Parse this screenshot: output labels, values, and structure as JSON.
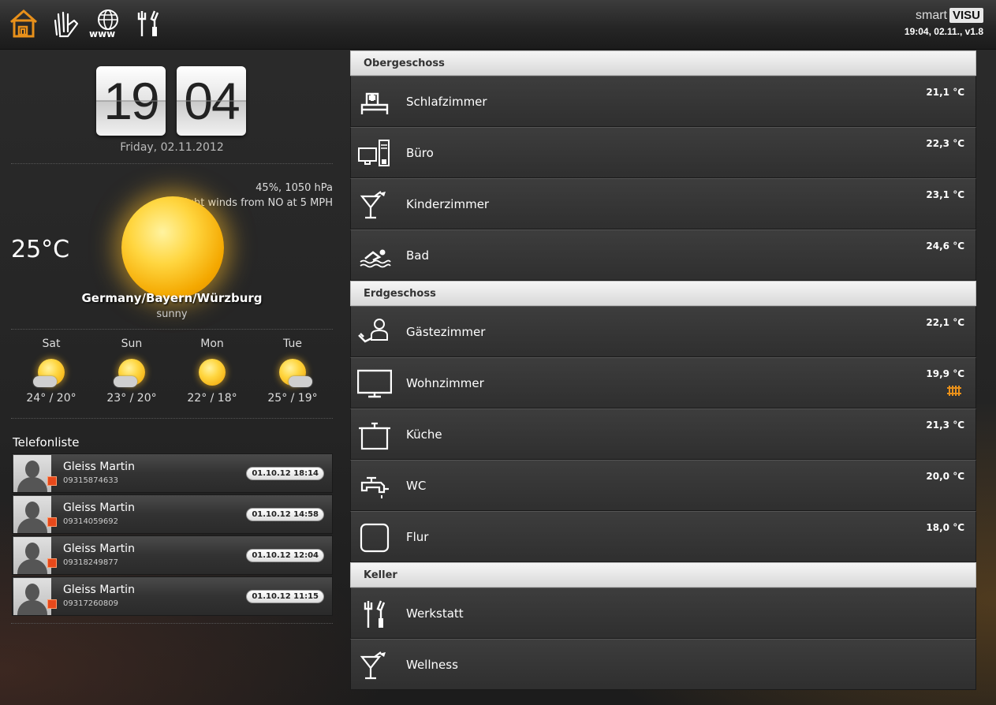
{
  "topbar": {
    "icons": [
      "home-icon",
      "hand-icon",
      "www-icon",
      "tools-icon"
    ],
    "brand_smart": "smart",
    "brand_visu": "VISU",
    "version": "19:04, 02.11., v1.8",
    "accent": "#e8901a"
  },
  "clock": {
    "hours": "19",
    "minutes": "04",
    "date": "Friday, 02.11.2012"
  },
  "weather": {
    "humidity_pressure": "45%, 1050 hPa",
    "wind": "light winds from NO at 5 MPH",
    "temperature": "25°C",
    "location": "Germany/Bayern/Würzburg",
    "condition": "sunny",
    "forecast": [
      {
        "day": "Sat",
        "range": "24° / 20°",
        "icon": "sun-cloud-icon"
      },
      {
        "day": "Sun",
        "range": "23° / 20°",
        "icon": "sun-cloud-icon"
      },
      {
        "day": "Mon",
        "range": "22° / 18°",
        "icon": "sun-icon"
      },
      {
        "day": "Tue",
        "range": "25° / 19°",
        "icon": "sun-cloud-icon"
      }
    ]
  },
  "phonelist": {
    "title": "Telefonliste",
    "calls": [
      {
        "name": "Gleiss Martin",
        "number": "09315874633",
        "time": "01.10.12 18:14"
      },
      {
        "name": "Gleiss Martin",
        "number": "09314059692",
        "time": "01.10.12 14:58"
      },
      {
        "name": "Gleiss Martin",
        "number": "09318249877",
        "time": "01.10.12 12:04"
      },
      {
        "name": "Gleiss Martin",
        "number": "09317260809",
        "time": "01.10.12 11:15"
      }
    ]
  },
  "floors": [
    {
      "title": "Obergeschoss",
      "rooms": [
        {
          "name": "Schlafzimmer",
          "temp": "21,1 °C",
          "icon": "bed-icon"
        },
        {
          "name": "Büro",
          "temp": "22,3 °C",
          "icon": "computer-icon"
        },
        {
          "name": "Kinderzimmer",
          "temp": "23,1 °C",
          "icon": "cocktail-icon"
        },
        {
          "name": "Bad",
          "temp": "24,6 °C",
          "icon": "swimmer-icon"
        }
      ]
    },
    {
      "title": "Erdgeschoss",
      "rooms": [
        {
          "name": "Gästezimmer",
          "temp": "22,1 °C",
          "icon": "guest-icon"
        },
        {
          "name": "Wohnzimmer",
          "temp": "19,9 °C",
          "icon": "tv-icon",
          "heating": true
        },
        {
          "name": "Küche",
          "temp": "21,3 °C",
          "icon": "pot-icon"
        },
        {
          "name": "WC",
          "temp": "20,0 °C",
          "icon": "faucet-icon"
        },
        {
          "name": "Flur",
          "temp": "18,0 °C",
          "icon": "square-icon"
        }
      ]
    },
    {
      "title": "Keller",
      "rooms": [
        {
          "name": "Werkstatt",
          "temp": "",
          "icon": "tools-icon"
        },
        {
          "name": "Wellness",
          "temp": "",
          "icon": "cocktail-icon"
        }
      ]
    }
  ]
}
